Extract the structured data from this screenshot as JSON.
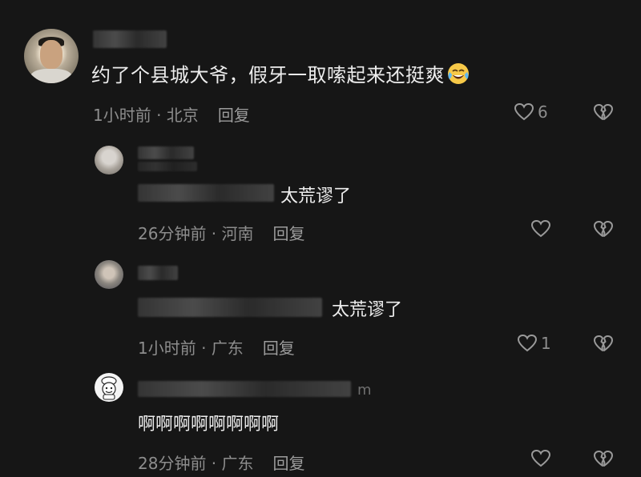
{
  "comments": [
    {
      "text": "约了个县城大爷，假牙一取嗦起来还挺爽",
      "emoji": "face-with-tears-of-joy",
      "time": "1小时前",
      "location": "北京",
      "reply_label": "回复",
      "likes": "6"
    }
  ],
  "replies": [
    {
      "text": "太荒谬了",
      "time": "26分钟前",
      "location": "河南",
      "reply_label": "回复",
      "likes": ""
    },
    {
      "text": "太荒谬了",
      "time": "1小时前",
      "location": "广东",
      "reply_label": "回复",
      "likes": "1"
    },
    {
      "name_suffix": "m",
      "text": "啊啊啊啊啊啊啊啊",
      "time": "28分钟前",
      "location": "广东",
      "reply_label": "回复",
      "likes": ""
    }
  ],
  "separator": " · ",
  "colors": {
    "background": "#161616",
    "text_primary": "#ededed",
    "text_secondary": "#8d8d8d"
  },
  "icons": [
    "heart-icon",
    "broken-heart-icon"
  ]
}
